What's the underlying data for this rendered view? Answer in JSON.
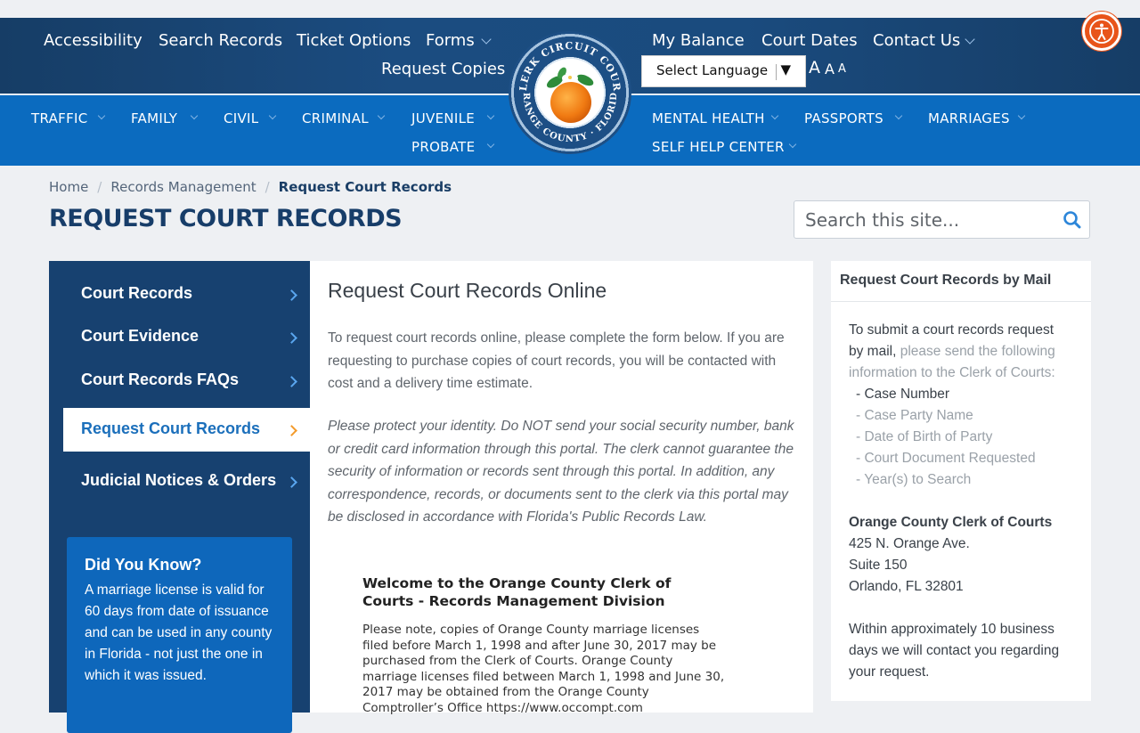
{
  "header": {
    "top_left_links": [
      "Accessibility",
      "Search Records",
      "Ticket Options",
      "Forms",
      "Request Copies"
    ],
    "top_right_links": [
      "My Balance",
      "Court Dates",
      "Contact Us"
    ],
    "language_select": "Select Language",
    "language_arrow": "▼",
    "font_size_controls": [
      "A",
      "A",
      "A"
    ],
    "nav_left": [
      "TRAFFIC",
      "FAMILY",
      "CIVIL",
      "CRIMINAL",
      "JUVENILE",
      "PROBATE"
    ],
    "nav_right": [
      "MENTAL HEALTH",
      "PASSPORTS",
      "MARRIAGES",
      "SELF HELP CENTER"
    ],
    "seal_text_top": "CLERK CIRCUIT COURT",
    "seal_text_bottom": "ORANGE COUNTY · FLORIDA"
  },
  "breadcrumb": {
    "items": [
      "Home",
      "Records Management"
    ],
    "current": "Request Court Records",
    "separator": "/"
  },
  "page_title": "REQUEST COURT RECORDS",
  "search": {
    "placeholder": "Search this site..."
  },
  "sidebar": {
    "items": [
      {
        "label": "Court Records"
      },
      {
        "label": "Court Evidence"
      },
      {
        "label": "Court Records FAQs"
      },
      {
        "label": "Request Court Records",
        "active": true
      },
      {
        "label": "Judicial Notices & Orders"
      }
    ],
    "did_you_know": {
      "title": "Did You Know?",
      "text": "A marriage license is valid for 60 days from date of issuance and can be used in any county in Florida - not just the one in which it was issued."
    }
  },
  "main": {
    "heading": "Request Court Records Online",
    "intro": "To request court records online, please complete the form below. If you are requesting to purchase copies of court records, you will be contacted with cost and a delivery time estimate.",
    "warning": "Please protect your identity. Do NOT send your social security number, bank or credit card information through this portal. The clerk cannot guarantee the security of information or records sent through this portal. In addition, any correspondence, records, or documents sent to the clerk via this portal may be disclosed in accordance with Florida's Public Records Law.",
    "welcome_heading": "Welcome to the Orange County Clerk of Courts - Records Management Division",
    "welcome_text": "Please note, copies of Orange County marriage licenses filed before March 1, 1998 and after June 30, 2017 may be purchased from the Clerk of Courts. Orange County marriage licenses filed between March 1, 1998 and June 30, 2017 may be obtained from the Orange County Comptroller’s Office https://www.occompt.com"
  },
  "right_panel": {
    "heading": "Request Court Records by Mail",
    "intro_dark": "To submit a court records request by mail,",
    "intro_light": " please send the following information to the Clerk of Courts:",
    "list": [
      "- Case Number",
      "- Case Party Name",
      "- Date of Birth of Party",
      "- Court Document Requested",
      "- Year(s) to Search"
    ],
    "address_title": "Orange County Clerk of Courts",
    "address_lines": [
      "425 N. Orange Ave.",
      "Suite 150",
      "Orlando, FL 32801"
    ],
    "closing": "Within approximately 10 business days we will contact you regarding your request."
  }
}
